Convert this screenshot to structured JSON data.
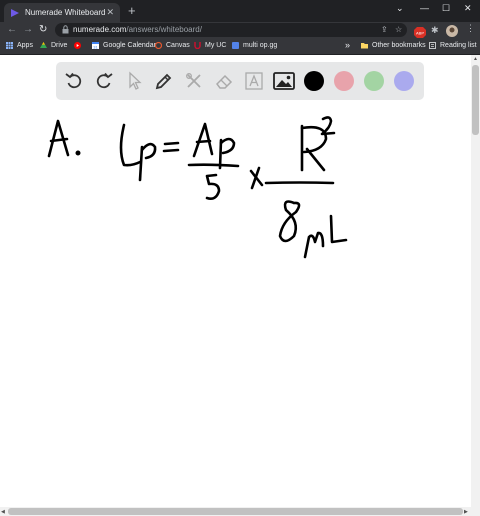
{
  "browser": {
    "tab_title": "Numerade Whiteboard",
    "tab_close": "✕",
    "new_tab": "+",
    "window_controls": {
      "minimize": "—",
      "maximize": "☐",
      "close": "✕"
    },
    "url_host": "numerade.com",
    "url_path": "/answers/whiteboard/",
    "extension_badge": "ABP"
  },
  "bookmarks": {
    "items": [
      {
        "label": "Apps",
        "color": "#8ab4f8"
      },
      {
        "label": "Drive",
        "color": "#34a853"
      },
      {
        "label": "",
        "color": "#ff0000"
      },
      {
        "label": "Google Calendar",
        "color": "#4285f4"
      },
      {
        "label": "Canvas",
        "color": "#e4572e"
      },
      {
        "label": "My UC",
        "color": "#c8102e"
      },
      {
        "label": "multi op.gg",
        "color": "#5383e8"
      }
    ],
    "overflow": "»",
    "other": "Other bookmarks",
    "reading_list": "Reading list"
  },
  "whiteboard": {
    "tools": [
      "undo-icon",
      "redo-icon",
      "select-icon",
      "pen-icon",
      "tools-icon",
      "eraser-icon",
      "text-icon",
      "image-icon"
    ],
    "colors": [
      "#000000",
      "#e8a3ab",
      "#a3d4a3",
      "#aaaaee"
    ]
  }
}
